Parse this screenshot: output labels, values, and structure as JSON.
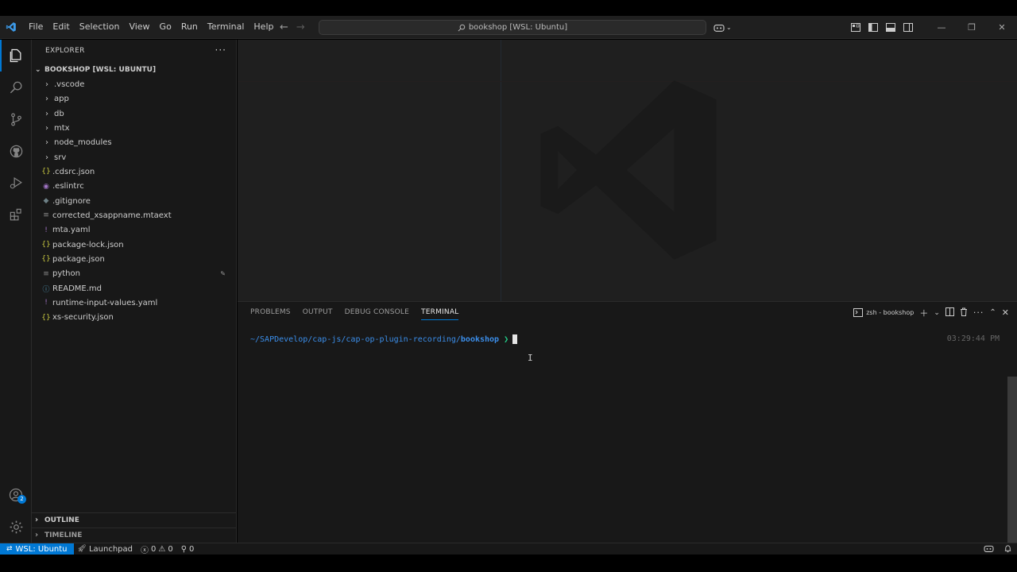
{
  "titlebar": {
    "menu": [
      "File",
      "Edit",
      "Selection",
      "View",
      "Go",
      "Run",
      "Terminal",
      "Help"
    ],
    "command_center": "bookshop [WSL: Ubuntu]"
  },
  "sidebar": {
    "header": "EXPLORER",
    "folder": "BOOKSHOP [WSL: UBUNTU]",
    "items": [
      {
        "label": ".vscode",
        "type": "folder"
      },
      {
        "label": "app",
        "type": "folder"
      },
      {
        "label": "db",
        "type": "folder"
      },
      {
        "label": "mtx",
        "type": "folder"
      },
      {
        "label": "node_modules",
        "type": "folder"
      },
      {
        "label": "srv",
        "type": "folder"
      },
      {
        "label": ".cdsrc.json",
        "type": "json"
      },
      {
        "label": ".eslintrc",
        "type": "eslint"
      },
      {
        "label": ".gitignore",
        "type": "git"
      },
      {
        "label": "corrected_xsappname.mtaext",
        "type": "text"
      },
      {
        "label": "mta.yaml",
        "type": "yaml"
      },
      {
        "label": "package-lock.json",
        "type": "json"
      },
      {
        "label": "package.json",
        "type": "json"
      },
      {
        "label": "python",
        "type": "text"
      },
      {
        "label": "README.md",
        "type": "md"
      },
      {
        "label": "runtime-input-values.yaml",
        "type": "yaml"
      },
      {
        "label": "xs-security.json",
        "type": "json"
      }
    ],
    "outline": "OUTLINE",
    "timeline": "TIMELINE",
    "accounts_badge": "2"
  },
  "panel": {
    "tabs": [
      "PROBLEMS",
      "OUTPUT",
      "DEBUG CONSOLE",
      "TERMINAL"
    ],
    "terminal_name": "zsh - bookshop",
    "path_prefix": "~/SAPDevelop/cap-js/cap-op-plugin-recording/",
    "path_bold": "bookshop",
    "prompt": "❯",
    "time": "03:29:44 PM"
  },
  "statusbar": {
    "remote": "WSL: Ubuntu",
    "launchpad": "Launchpad",
    "errors": "0",
    "warnings": "0",
    "ports": "0"
  },
  "colors": {
    "accent": "#0078d4",
    "terminal_path": "#3b8eea",
    "prompt": "#23d18b"
  }
}
